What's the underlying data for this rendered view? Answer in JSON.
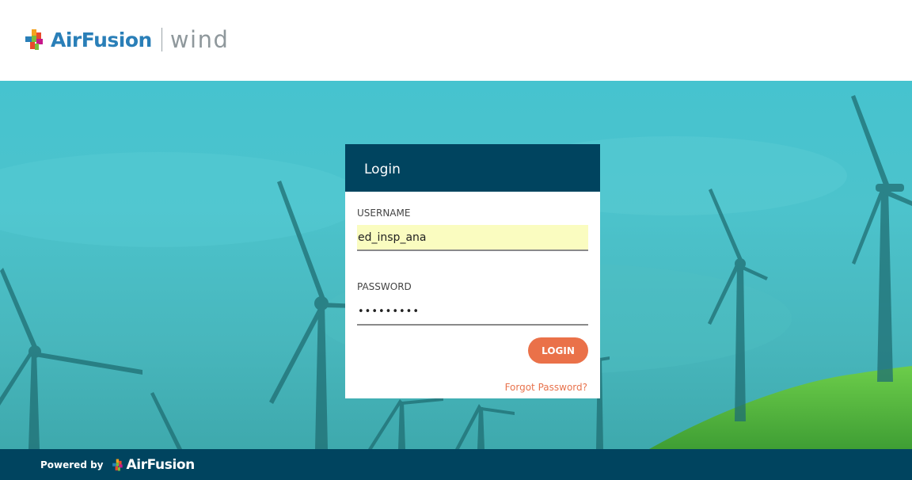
{
  "header": {
    "brand_name": "AirFusion",
    "product_name": "wind"
  },
  "login": {
    "title": "Login",
    "username_label": "USERNAME",
    "username_value": "ed_insp_ana",
    "password_label": "PASSWORD",
    "password_value": "•••••••••",
    "login_button": "LOGIN",
    "forgot_link": "Forgot Password?"
  },
  "footer": {
    "powered_by": "Powered by",
    "brand_name": "AirFusion"
  },
  "colors": {
    "primary_dark": "#00445f",
    "accent_orange": "#ea7149",
    "brand_blue": "#2a7fb8"
  }
}
